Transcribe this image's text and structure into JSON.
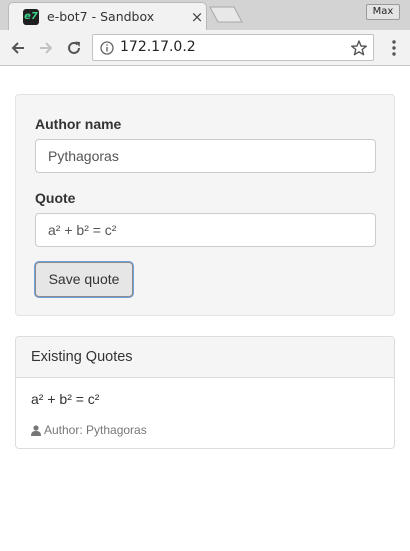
{
  "browser": {
    "tab_title": "e-bot7 - Sandbox",
    "favicon_text": "e7",
    "close_glyph": "×",
    "max_label": "Max",
    "url": "172.17.0.2",
    "icons": [
      "back-arrow-icon",
      "forward-arrow-icon",
      "reload-icon",
      "info-icon",
      "star-icon",
      "menu-dots-icon",
      "new-tab-icon"
    ]
  },
  "form": {
    "author_label": "Author name",
    "author_value": "Pythagoras",
    "quote_label": "Quote",
    "quote_value": "a² + b² = c²",
    "save_label": "Save quote",
    "focus_color": "#6fa0dd"
  },
  "quotes": {
    "heading": "Existing Quotes",
    "items": [
      {
        "text": "a² + b² = c²",
        "author": "Author: Pythagoras"
      }
    ]
  }
}
